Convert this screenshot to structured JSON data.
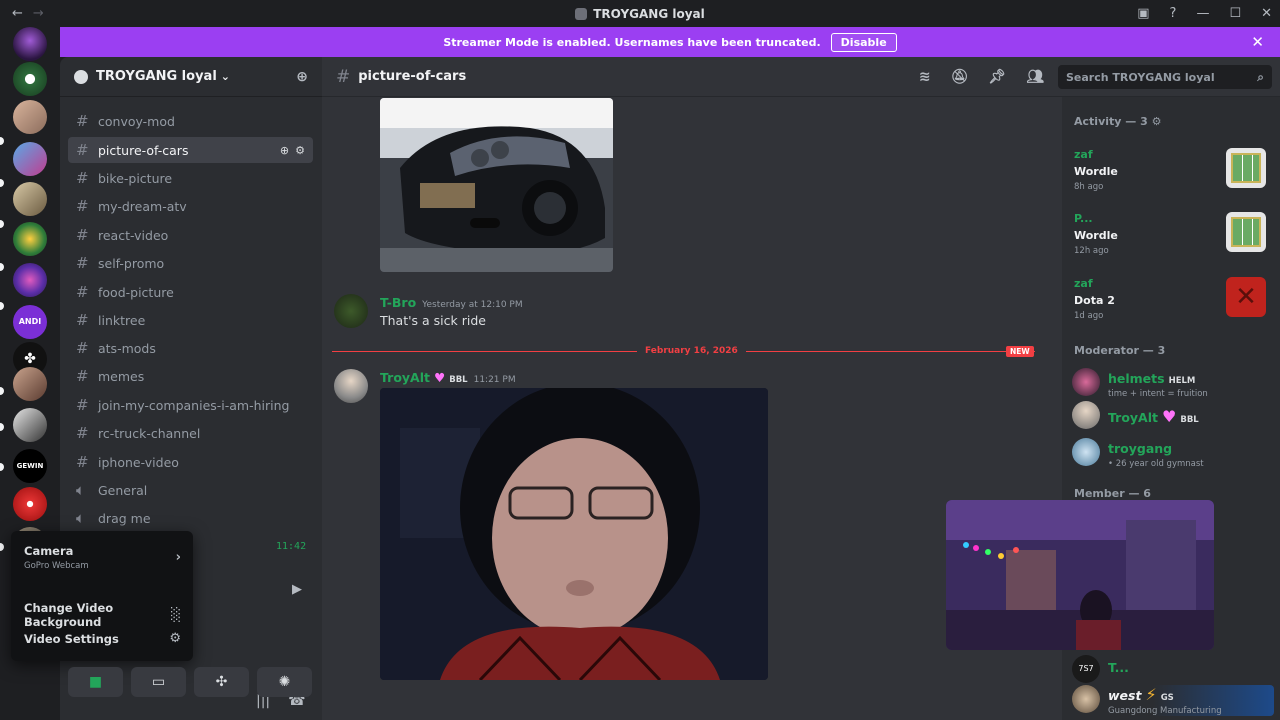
{
  "window": {
    "title": "TROYGANG loyal",
    "back": "←",
    "forward": "→",
    "controls": {
      "minimize": "—",
      "maximize": "☐",
      "close": "✕"
    }
  },
  "banner": {
    "text": "Streamer Mode is enabled. Usernames have been truncated.",
    "button": "Disable",
    "close": "✕",
    "color": "#9b3ff2"
  },
  "guild": {
    "name": "TROYGANG loyal",
    "chevron": "⌄"
  },
  "channels": [
    {
      "name": "convoy-mod",
      "type": "text"
    },
    {
      "name": "picture-of-cars",
      "type": "text",
      "active": true
    },
    {
      "name": "bike-picture",
      "type": "text"
    },
    {
      "name": "my-dream-atv",
      "type": "text"
    },
    {
      "name": "react-video",
      "type": "text"
    },
    {
      "name": "self-promo",
      "type": "text"
    },
    {
      "name": "food-picture",
      "type": "text"
    },
    {
      "name": "linktree",
      "type": "text"
    },
    {
      "name": "ats-mods",
      "type": "text"
    },
    {
      "name": "memes",
      "type": "text"
    },
    {
      "name": "join-my-companies-i-am-hiring",
      "type": "text"
    },
    {
      "name": "rc-truck-channel",
      "type": "text"
    },
    {
      "name": "iphone-video",
      "type": "text"
    },
    {
      "name": "General",
      "type": "voice"
    },
    {
      "name": "drag me",
      "type": "voice"
    }
  ],
  "popup": {
    "camera_label": "Camera",
    "camera_device": "GoPro Webcam",
    "change_bg": "Change Video Background",
    "video_settings": "Video Settings"
  },
  "voice": {
    "timer": "11:42"
  },
  "chat": {
    "channel": "picture-of-cars",
    "search_placeholder": "Search TROYGANG loyal",
    "messages": [
      {
        "author": "T-Bro",
        "time": "Yesterday at 12:10 PM",
        "text": "That's a sick ride",
        "color": "#23a55a"
      },
      {
        "author": "TroyAlt",
        "tag": "BBL",
        "time": "11:21 PM",
        "color": "#23a55a"
      }
    ],
    "divider_date": "February 16, 2026",
    "new_label": "NEW"
  },
  "members": {
    "activity_header": "Activity — 3",
    "activities": [
      {
        "name": "zaf",
        "game": "Wordle",
        "ago": "8h ago"
      },
      {
        "name": "P...",
        "game": "Wordle",
        "ago": "12h ago"
      },
      {
        "name": "zaf",
        "game": "Dota 2",
        "ago": "1d ago"
      }
    ],
    "moderator_header": "Moderator — 3",
    "moderators": [
      {
        "name": "helmets",
        "tag": "HELM",
        "status": "time + intent = fruition",
        "color": "#23a55a"
      },
      {
        "name": "TroyAlt",
        "tag": "BBL",
        "status": "",
        "color": "#23a55a"
      },
      {
        "name": "troygang",
        "tag": "",
        "status": "• 26 year old gymnast",
        "color": "#23a55a"
      }
    ],
    "member_header": "Member — 6",
    "members_list": [
      {
        "name": "T...",
        "tag": "",
        "status": ""
      },
      {
        "name": "west",
        "tag": "GS",
        "status": "Guangdong Manufacturing"
      }
    ]
  },
  "colors": {
    "accent_green": "#23a55a",
    "danger": "#f23f43",
    "banner": "#9b3ff2"
  }
}
